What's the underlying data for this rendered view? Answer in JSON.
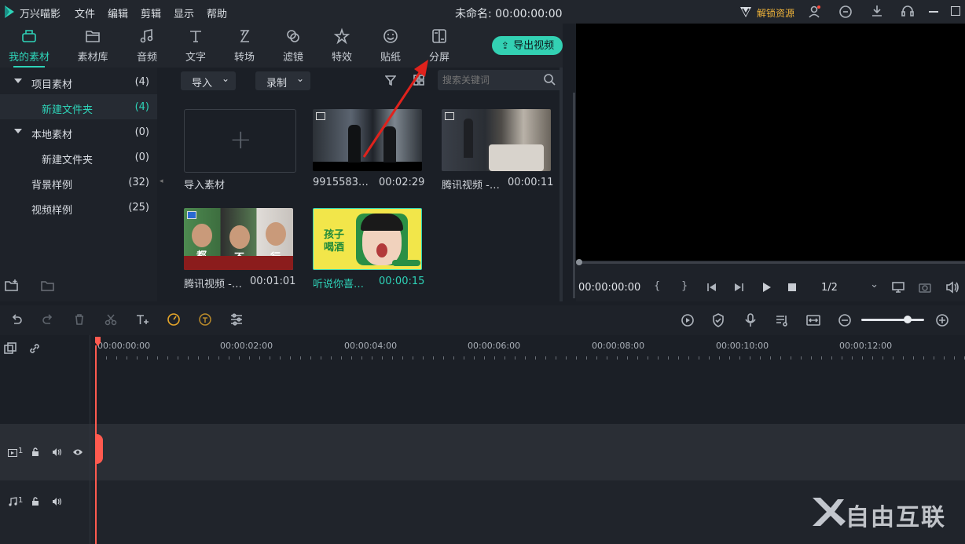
{
  "app": {
    "name": "万兴喵影",
    "title": "未命名: 00:00:00:00",
    "unlock": "解锁资源"
  },
  "menu": [
    "文件",
    "编辑",
    "剪辑",
    "显示",
    "帮助"
  ],
  "tools": [
    {
      "label": "我的素材",
      "icon": "folder-icon"
    },
    {
      "label": "素材库",
      "icon": "library-icon"
    },
    {
      "label": "音频",
      "icon": "music-icon"
    },
    {
      "label": "文字",
      "icon": "text-icon"
    },
    {
      "label": "转场",
      "icon": "transition-icon"
    },
    {
      "label": "滤镜",
      "icon": "filter-icon"
    },
    {
      "label": "特效",
      "icon": "effects-icon"
    },
    {
      "label": "贴纸",
      "icon": "sticker-icon"
    },
    {
      "label": "分屏",
      "icon": "split-screen-icon"
    }
  ],
  "export_label": "导出视频",
  "tree": [
    {
      "label": "项目素材",
      "count": "(4)"
    },
    {
      "label": "新建文件夹",
      "count": "(4)"
    },
    {
      "label": "本地素材",
      "count": "(0)"
    },
    {
      "label": "新建文件夹",
      "count": "(0)"
    },
    {
      "label": "背景样例",
      "count": "(32)"
    },
    {
      "label": "视频样例",
      "count": "(25)"
    }
  ],
  "media_toolbar": {
    "import": "导入",
    "record": "录制",
    "search_placeholder": "搜索关键词"
  },
  "media": [
    {
      "name": "导入素材",
      "duration": ""
    },
    {
      "name": "9915583…",
      "duration": "00:02:29"
    },
    {
      "name": "腾讯视频 -…",
      "duration": "00:00:11"
    },
    {
      "name": "腾讯视频 -…",
      "duration": "00:01:01"
    },
    {
      "name": "听说你喜…",
      "duration": "00:00:15"
    }
  ],
  "thumb_text": {
    "t4a": "都",
    "t4b": "不",
    "t4c": "行",
    "t5a": "孩子",
    "t5b": "喝酒"
  },
  "preview": {
    "time": "00:00:00:00",
    "ratio": "1/2",
    "brace_open": "{",
    "brace_close": "}"
  },
  "ruler": [
    "00:00:00:00",
    "00:00:02:00",
    "00:00:04:00",
    "00:00:06:00",
    "00:00:08:00",
    "00:00:10:00",
    "00:00:12:00"
  ],
  "tracks": {
    "video": "1",
    "audio": "1"
  },
  "watermark": "自由互联",
  "colors": {
    "accent": "#2ed3b8",
    "playhead": "#ff5a4f",
    "arrow": "#e0221c"
  }
}
